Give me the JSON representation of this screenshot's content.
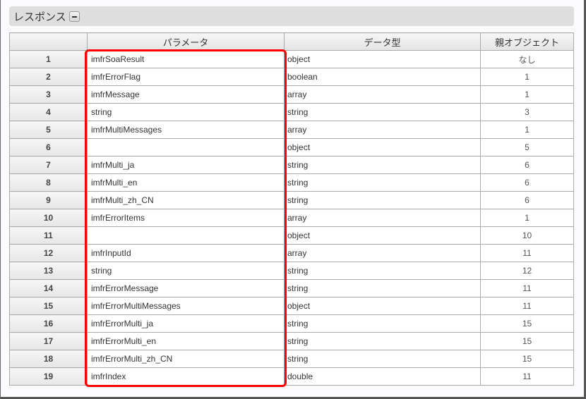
{
  "section": {
    "title": "レスポンス",
    "toggle_icon": "minus-icon"
  },
  "columns": [
    "",
    "パラメータ",
    "データ型",
    "親オブジェクト"
  ],
  "rows": [
    {
      "no": "1",
      "param": "imfrSoaResult",
      "type": "object",
      "parent": "なし"
    },
    {
      "no": "2",
      "param": "imfrErrorFlag",
      "type": "boolean",
      "parent": "1"
    },
    {
      "no": "3",
      "param": "imfrMessage",
      "type": "array",
      "parent": "1"
    },
    {
      "no": "4",
      "param": "string",
      "type": "string",
      "parent": "3"
    },
    {
      "no": "5",
      "param": "imfrMultiMessages",
      "type": "array",
      "parent": "1"
    },
    {
      "no": "6",
      "param": "",
      "type": "object",
      "parent": "5"
    },
    {
      "no": "7",
      "param": "imfrMulti_ja",
      "type": "string",
      "parent": "6"
    },
    {
      "no": "8",
      "param": "imfrMulti_en",
      "type": "string",
      "parent": "6"
    },
    {
      "no": "9",
      "param": "imfrMulti_zh_CN",
      "type": "string",
      "parent": "6"
    },
    {
      "no": "10",
      "param": "imfrErrorItems",
      "type": "array",
      "parent": "1"
    },
    {
      "no": "11",
      "param": "",
      "type": "object",
      "parent": "10"
    },
    {
      "no": "12",
      "param": "imfrInputId",
      "type": "array",
      "parent": "11"
    },
    {
      "no": "13",
      "param": "string",
      "type": "string",
      "parent": "12"
    },
    {
      "no": "14",
      "param": "imfrErrorMessage",
      "type": "string",
      "parent": "11"
    },
    {
      "no": "15",
      "param": "imfrErrorMultiMessages",
      "type": "object",
      "parent": "11"
    },
    {
      "no": "16",
      "param": "imfrErrorMulti_ja",
      "type": "string",
      "parent": "15"
    },
    {
      "no": "17",
      "param": "imfrErrorMulti_en",
      "type": "string",
      "parent": "15"
    },
    {
      "no": "18",
      "param": "imfrErrorMulti_zh_CN",
      "type": "string",
      "parent": "15"
    },
    {
      "no": "19",
      "param": "imfrIndex",
      "type": "double",
      "parent": "11"
    }
  ],
  "highlight_color": "#ff0000"
}
